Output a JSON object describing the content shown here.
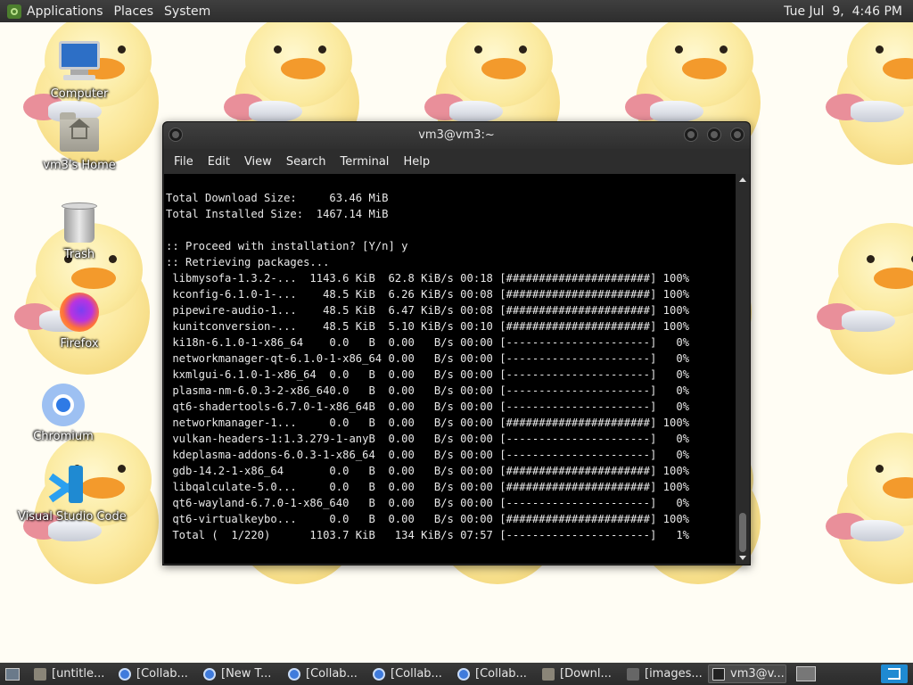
{
  "top_panel": {
    "menus": [
      "Applications",
      "Places",
      "System"
    ],
    "clock": "Tue Jul  9,  4:46 PM"
  },
  "desktop_icons": [
    {
      "label": "Computer",
      "icon": "computer-icon"
    },
    {
      "label": "vm3's Home",
      "icon": "home-folder-icon"
    },
    {
      "label": "Trash",
      "icon": "trash-icon"
    },
    {
      "label": "Firefox",
      "icon": "firefox-icon"
    },
    {
      "label": "Chromium",
      "icon": "chromium-icon"
    },
    {
      "label": "Visual Studio Code",
      "icon": "vscode-icon"
    }
  ],
  "terminal": {
    "title": "vm3@vm3:~",
    "menu": [
      "File",
      "Edit",
      "View",
      "Search",
      "Terminal",
      "Help"
    ],
    "lines": [
      "Total Download Size:     63.46 MiB",
      "Total Installed Size:  1467.14 MiB",
      "",
      ":: Proceed with installation? [Y/n] y",
      ":: Retrieving packages...",
      " libmysofa-1.3.2-...  1143.6 KiB  62.8 KiB/s 00:18 [######################] 100%",
      " kconfig-6.1.0-1-...    48.5 KiB  6.26 KiB/s 00:08 [######################] 100%",
      " pipewire-audio-1...    48.5 KiB  6.47 KiB/s 00:08 [######################] 100%",
      " kunitconversion-...    48.5 KiB  5.10 KiB/s 00:10 [######################] 100%",
      " ki18n-6.1.0-1-x86_64    0.0   B  0.00   B/s 00:00 [----------------------]   0%",
      " networkmanager-qt-6.1.0-1-x86_64 0.00   B/s 00:00 [----------------------]   0%",
      " kxmlgui-6.1.0-1-x86_64  0.0   B  0.00   B/s 00:00 [----------------------]   0%",
      " plasma-nm-6.0.3-2-x86_640.0   B  0.00   B/s 00:00 [----------------------]   0%",
      " qt6-shadertools-6.7.0-1-x86_64B  0.00   B/s 00:00 [----------------------]   0%",
      " networkmanager-1...     0.0   B  0.00   B/s 00:00 [######################] 100%",
      " vulkan-headers-1:1.3.279-1-anyB  0.00   B/s 00:00 [----------------------]   0%",
      " kdeplasma-addons-6.0.3-1-x86_64  0.00   B/s 00:00 [----------------------]   0%",
      " gdb-14.2-1-x86_64       0.0   B  0.00   B/s 00:00 [######################] 100%",
      " libqalculate-5.0...     0.0   B  0.00   B/s 00:00 [######################] 100%",
      " qt6-wayland-6.7.0-1-x86_640   B  0.00   B/s 00:00 [----------------------]   0%",
      " qt6-virtualkeybo...     0.0   B  0.00   B/s 00:00 [######################] 100%",
      " Total (  1/220)      1103.7 KiB   134 KiB/s 07:57 [----------------------]   1%"
    ]
  },
  "taskbar": {
    "tasks": [
      {
        "label": "[untitle...",
        "icon": "folder-icon",
        "active": false
      },
      {
        "label": "[Collab...",
        "icon": "chromium-icon",
        "active": false
      },
      {
        "label": "[New T...",
        "icon": "chromium-icon",
        "active": false
      },
      {
        "label": "[Collab...",
        "icon": "chromium-icon",
        "active": false
      },
      {
        "label": "[Collab...",
        "icon": "chromium-icon",
        "active": false
      },
      {
        "label": "[Collab...",
        "icon": "chromium-icon",
        "active": false
      },
      {
        "label": "[Downl...",
        "icon": "folder-icon",
        "active": false
      },
      {
        "label": "[images...",
        "icon": "image-viewer-icon",
        "active": false
      },
      {
        "label": "vm3@v...",
        "icon": "terminal-icon",
        "active": true
      }
    ]
  }
}
